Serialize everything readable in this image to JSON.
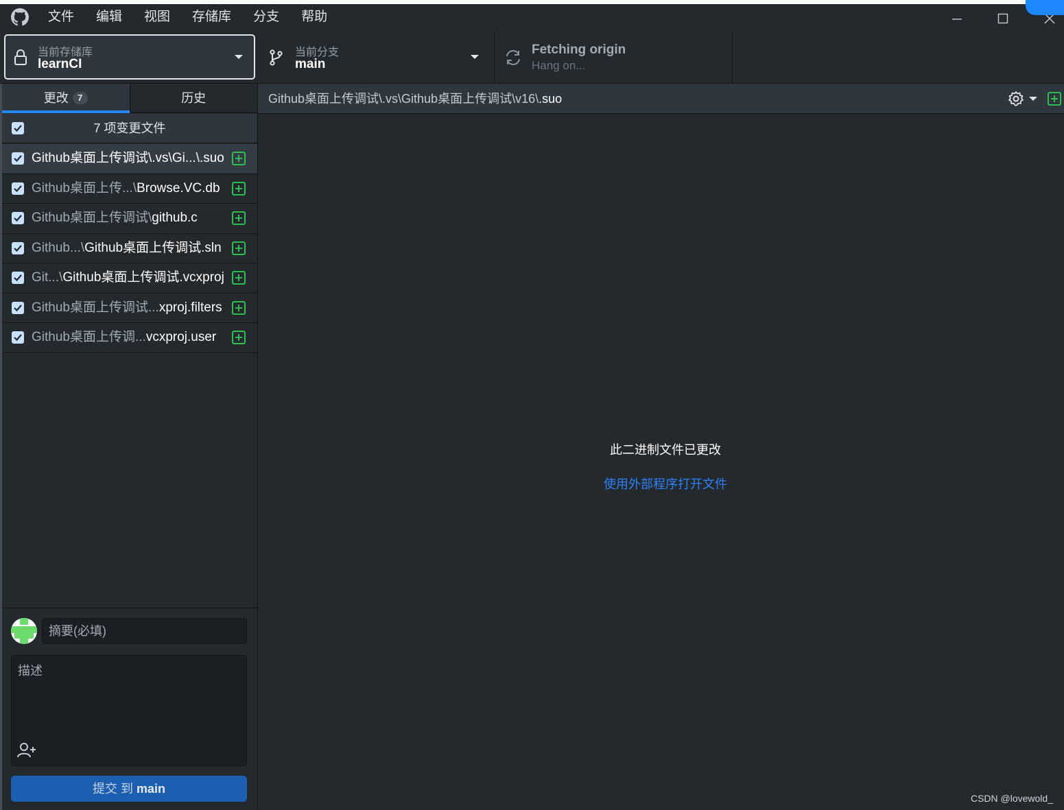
{
  "menu": {
    "items": [
      "文件",
      "编辑",
      "视图",
      "存储库",
      "分支",
      "帮助"
    ]
  },
  "toolbar": {
    "repository": {
      "label": "当前存储库",
      "value": "learnCI"
    },
    "branch": {
      "label": "当前分支",
      "value": "main"
    },
    "fetch": {
      "title": "Fetching origin",
      "subtitle": "Hang on..."
    }
  },
  "tabs": {
    "changes": {
      "label": "更改",
      "count": "7"
    },
    "history": {
      "label": "历史"
    }
  },
  "changes": {
    "summary": "7 项变更文件",
    "files": [
      {
        "dir": "Github桌面上传调试\\.vs\\Gi...\\",
        "base": ".suo"
      },
      {
        "dir": "Github桌面上传...\\",
        "base": "Browse.VC.db"
      },
      {
        "dir": "Github桌面上传调试\\",
        "base": "github.c"
      },
      {
        "dir": "Github...\\",
        "base": "Github桌面上传调试.sln"
      },
      {
        "dir": "Git...\\",
        "base": "Github桌面上传调试.vcxproj"
      },
      {
        "dir": "Github桌面上传调试...",
        "base": "xproj.filters"
      },
      {
        "dir": "Github桌面上传调...",
        "base": "vcxproj.user"
      }
    ]
  },
  "commit": {
    "summary_placeholder": "摘要(必填)",
    "description_placeholder": "描述",
    "button_prefix": "提交 到 ",
    "button_branch": "main"
  },
  "diff": {
    "path_dir": "Github桌面上传调试\\.vs\\Github桌面上传调试\\v16\\",
    "path_base": ".suo",
    "message": "此二进制文件已更改",
    "open_external": "使用外部程序打开文件"
  },
  "watermark": "CSDN @lovewold_",
  "colors": {
    "background": "#24292e",
    "panel": "#2f363d",
    "accent_blue": "#2188ff",
    "added_green": "#2cbe4e",
    "commit_button": "#1c5eb0"
  }
}
